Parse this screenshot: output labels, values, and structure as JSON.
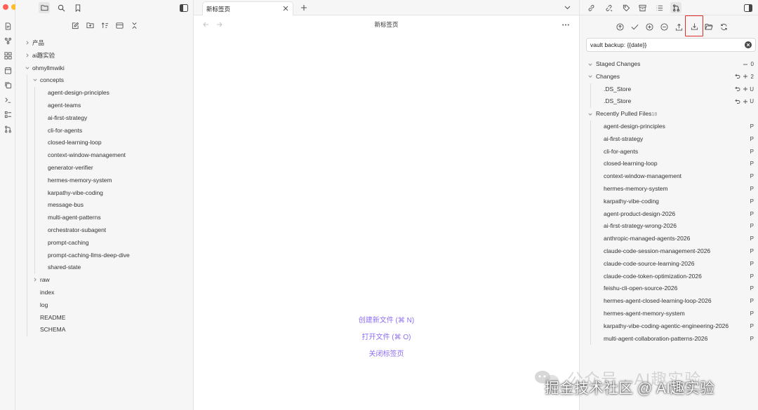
{
  "window": {
    "traffic_lights": [
      "#ff5f57",
      "#febc2e",
      "#28c840"
    ],
    "accent_color": "#8d6ff5",
    "highlight_color": "#e02b2b"
  },
  "left_sidebar": {
    "top_tabs": [
      "folder-icon",
      "search-icon",
      "bookmark-icon"
    ],
    "ribbon_icons": [
      "file-icon",
      "graph-icon",
      "canvas-icon",
      "calendar-icon",
      "copy-icon",
      "terminal-icon",
      "list-icon",
      "git-icon"
    ],
    "toolbar_icons": [
      "new-note-icon",
      "new-folder-icon",
      "sort-icon",
      "collapse-icon",
      "collapse-all-icon"
    ],
    "tree": {
      "top": [
        "产品",
        "ai趣实验"
      ],
      "vault": "ohmyllmwiki",
      "folder": "concepts",
      "concepts": [
        "agent-design-principles",
        "agent-teams",
        "ai-first-strategy",
        "cli-for-agents",
        "closed-learning-loop",
        "context-window-management",
        "generator-verifier",
        "hermes-memory-system",
        "karpathy-vibe-coding",
        "message-bus",
        "multi-agent-patterns",
        "orchestrator-subagent",
        "prompt-caching",
        "prompt-caching-llms-deep-dive",
        "shared-state"
      ],
      "raw": "raw",
      "files": [
        "index",
        "log",
        "README",
        "SCHEMA"
      ]
    }
  },
  "main": {
    "tab_label": "新标签页",
    "view_title": "新标签页",
    "actions": [
      "创建新文件 (⌘ N)",
      "打开文件 (⌘ O)",
      "关闭标签页"
    ]
  },
  "right_panel": {
    "top_icons": [
      "link-icon",
      "unlink-icon",
      "tag-icon",
      "archive-icon",
      "list-icon",
      "git-icon"
    ],
    "git_toolbar": [
      "commit-all-icon",
      "commit-icon",
      "stage-all-icon",
      "unstage-all-icon",
      "push-icon",
      "pull-icon",
      "open-folder-icon",
      "refresh-icon"
    ],
    "commit_message": "vault backup: {{date}}",
    "staged": {
      "label": "Staged Changes",
      "count": "0"
    },
    "changes": {
      "label": "Changes",
      "count": "2",
      "files": [
        {
          "name": ".DS_Store",
          "status": "U"
        },
        {
          "name": ".DS_Store",
          "status": "U"
        }
      ]
    },
    "pulled": {
      "label": "Recently Pulled Files",
      "count": "18",
      "files": [
        "agent-design-principles",
        "ai-first-strategy",
        "cli-for-agents",
        "closed-learning-loop",
        "context-window-management",
        "hermes-memory-system",
        "karpathy-vibe-coding",
        "agent-product-design-2026",
        "ai-first-strategy-wrong-2026",
        "anthropic-managed-agents-2026",
        "claude-code-session-management-2026",
        "claude-code-source-learning-2026",
        "claude-code-token-optimization-2026",
        "feishu-cli-open-source-2026",
        "hermes-agent-closed-learning-loop-2026",
        "hermes-agent-memory-system",
        "karpathy-vibe-coding-agentic-engineering-2026",
        "multi-agent-collaboration-patterns-2026"
      ],
      "status": "P"
    }
  },
  "watermark": {
    "line1": "公众号 · AI趣实验",
    "line2": "掘金技术社区 @ AI趣实验"
  }
}
